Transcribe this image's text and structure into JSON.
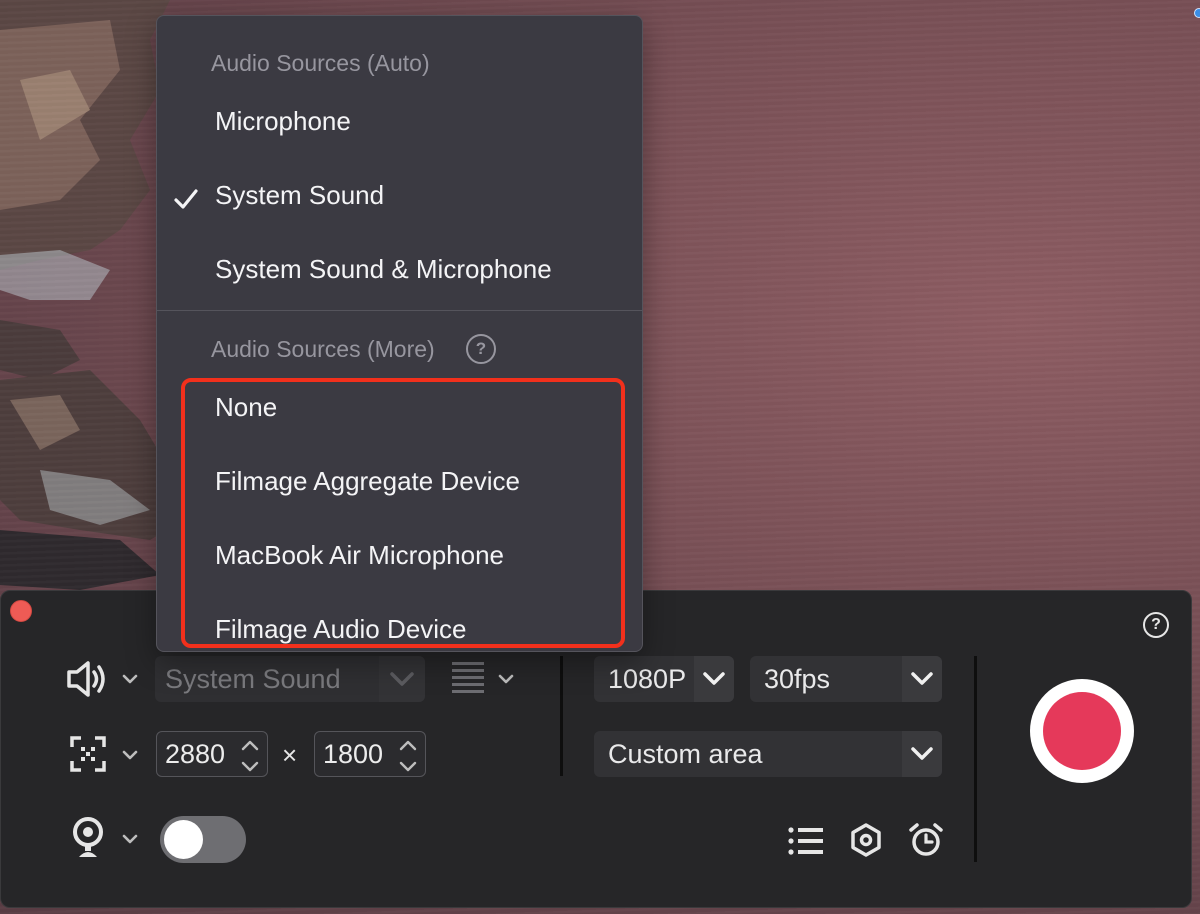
{
  "menu": {
    "header_auto": "Audio Sources (Auto)",
    "auto_items": [
      {
        "label": "Microphone",
        "checked": false
      },
      {
        "label": "System Sound",
        "checked": true
      },
      {
        "label": "System Sound & Microphone",
        "checked": false
      }
    ],
    "header_more": "Audio Sources (More)",
    "more_items": [
      {
        "label": "None"
      },
      {
        "label": "Filmage Aggregate Device"
      },
      {
        "label": "MacBook Air Microphone"
      },
      {
        "label": "Filmage Audio Device"
      }
    ],
    "help_glyph": "?",
    "highlight_color": "#f2301c"
  },
  "recorder": {
    "help_glyph": "?",
    "audio_source_value": "System Sound",
    "width_value": "2880",
    "times_glyph": "×",
    "height_value": "1800",
    "resolution_value": "1080P",
    "fps_value": "30fps",
    "area_value": "Custom area",
    "webcam_toggle_on": false,
    "record_color": "#e5395a",
    "icons": {
      "speaker": "speaker-icon",
      "region": "region-select-icon",
      "webcam": "webcam-icon",
      "levels": "audio-levels-icon",
      "list": "list-icon",
      "settings": "hexagon-settings-icon",
      "alarm": "alarm-clock-icon"
    }
  }
}
